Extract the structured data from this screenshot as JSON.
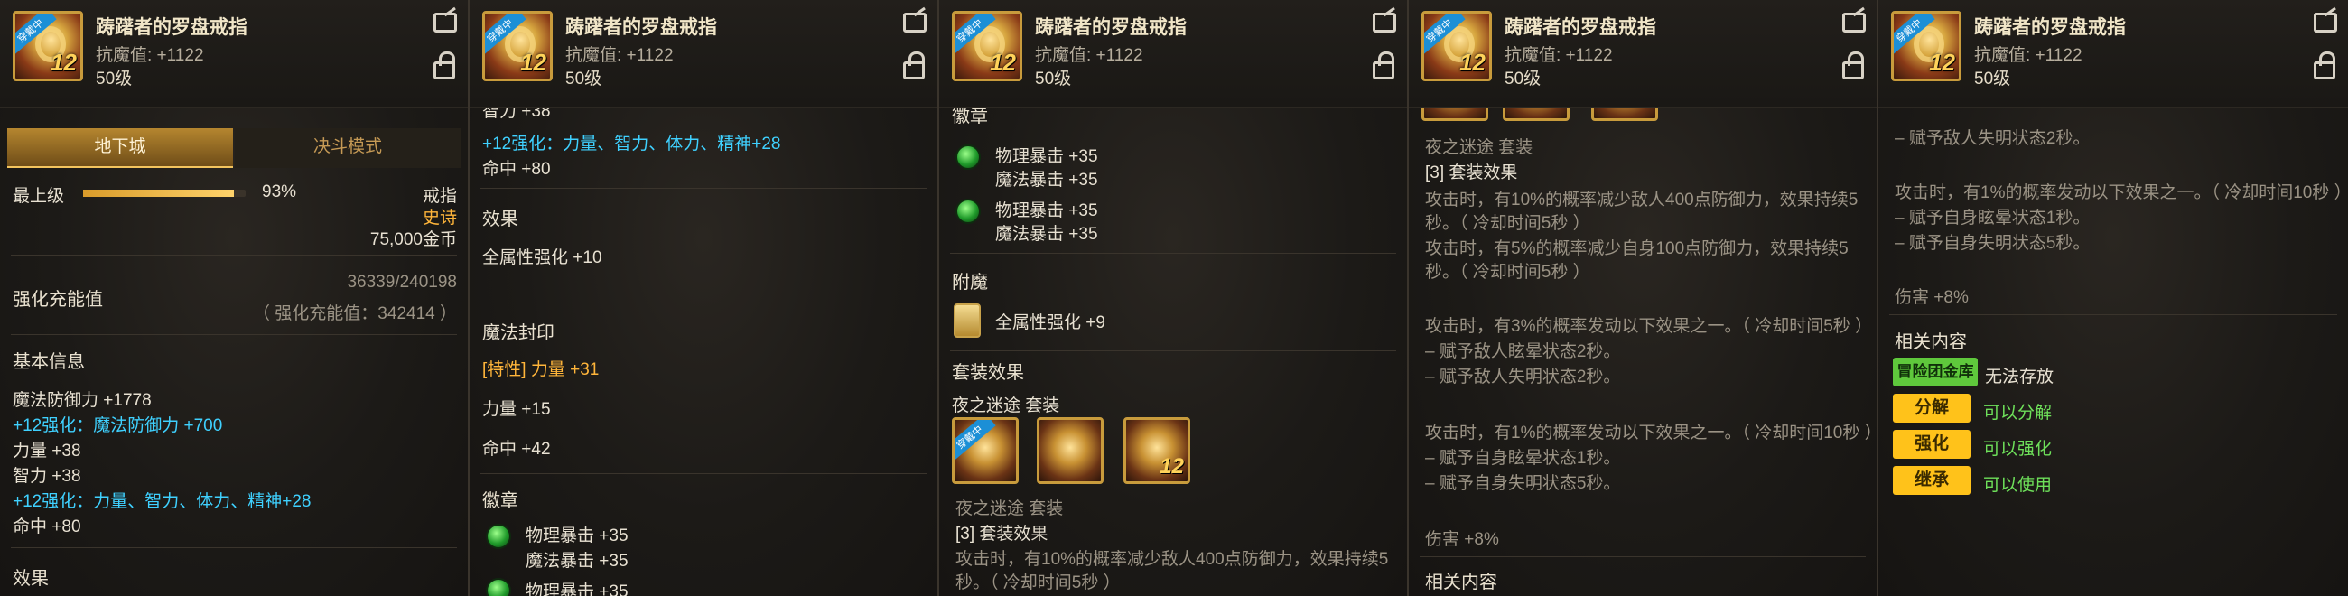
{
  "item": {
    "name": "踌躇者的罗盘戒指",
    "resist": "抗魔值: +1122",
    "level": "50级",
    "icon_level": "12",
    "equipped_tag": "穿戴中"
  },
  "colors": {
    "gold": "#ffb53a",
    "cyan": "#3fd1ff",
    "green": "#6ee05a",
    "button_yellow": "#ffc21a"
  },
  "p1": {
    "tabs": [
      "地下城",
      "决斗模式"
    ],
    "top_label": "最上级",
    "top_pct": "93%",
    "progress": 0.93,
    "type": "戒指",
    "rarity": "史诗",
    "price": "75,000金币",
    "charge_label": "强化充能值",
    "charge_value": "36339/240198",
    "charge_sub": "（ 强化充能值：342414 ）",
    "basic_title": "基本信息",
    "lines": [
      "魔法防御力 +1778",
      "+12强化：魔法防御力 +700",
      "力量 +38",
      "智力 +38",
      "+12强化：力量、智力、体力、精神+28",
      "命中 +80"
    ],
    "effect_title": "效果"
  },
  "p2": {
    "top_partial": "智力 +38",
    "enh": "+12强化：力量、智力、体力、精神+28",
    "hit": "命中 +80",
    "effect_title": "效果",
    "effect_line": "全属性强化 +10",
    "seal_title": "魔法封印",
    "seal1": "[特性] 力量 +31",
    "seal2": "力量 +15",
    "seal3": "命中 +42",
    "emblem_title": "徽章",
    "emb1": "物理暴击 +35",
    "emb2": "魔法暴击 +35",
    "emb3": "物理暴击 +35"
  },
  "p3": {
    "emblem_title": "徽章",
    "e1": "物理暴击 +35",
    "e2": "魔法暴击 +35",
    "e3": "物理暴击 +35",
    "e4": "魔法暴击 +35",
    "enchant_title": "附魔",
    "enchant": "全属性强化 +9",
    "set_title": "套装效果",
    "set_name": "夜之迷途 套装",
    "set_name2": "夜之迷途  套装",
    "set_count": "[3] 套装效果",
    "set_desc1": "攻击时，有10%的概率减少敌人400点防御力，效果持续5",
    "set_desc2": "秒。（ 冷却时间5秒 ）"
  },
  "p4": {
    "set_name": "夜之迷途  套装",
    "set_count": "[3] 套装效果",
    "l1": "攻击时，有10%的概率减少敌人400点防御力，效果持续5",
    "l2": "秒。（ 冷却时间5秒 ）",
    "l3": "攻击时，有5%的概率减少自身100点防御力，效果持续5",
    "l4": "秒。（ 冷却时间5秒 ）",
    "l5": "攻击时，有3%的概率发动以下效果之一。（ 冷却时间5秒 ）",
    "l6": "– 赋予敌人眩晕状态2秒。",
    "l7": "– 赋予敌人失明状态2秒。",
    "l8": "攻击时，有1%的概率发动以下效果之一。（ 冷却时间10秒 ）",
    "l9": "– 赋予自身眩晕状态1秒。",
    "l10": "– 赋予自身失明状态5秒。",
    "dmg": "伤害 +8%",
    "related_title": "相关内容"
  },
  "p5": {
    "l0": "– 赋予敌人失明状态2秒。",
    "l1": "攻击时，有1%的概率发动以下效果之一。（ 冷却时间10秒 ）",
    "l2": "– 赋予自身眩晕状态1秒。",
    "l3": "– 赋予自身失明状态5秒。",
    "dmg": "伤害 +8%",
    "related_title": "相关内容",
    "r1_btn": "冒险团金库",
    "r1_text": "无法存放",
    "r2_btn": "分解",
    "r2_text": "可以分解",
    "r3_btn": "强化",
    "r3_text": "可以强化",
    "r4_btn": "继承",
    "r4_text": "可以使用"
  }
}
